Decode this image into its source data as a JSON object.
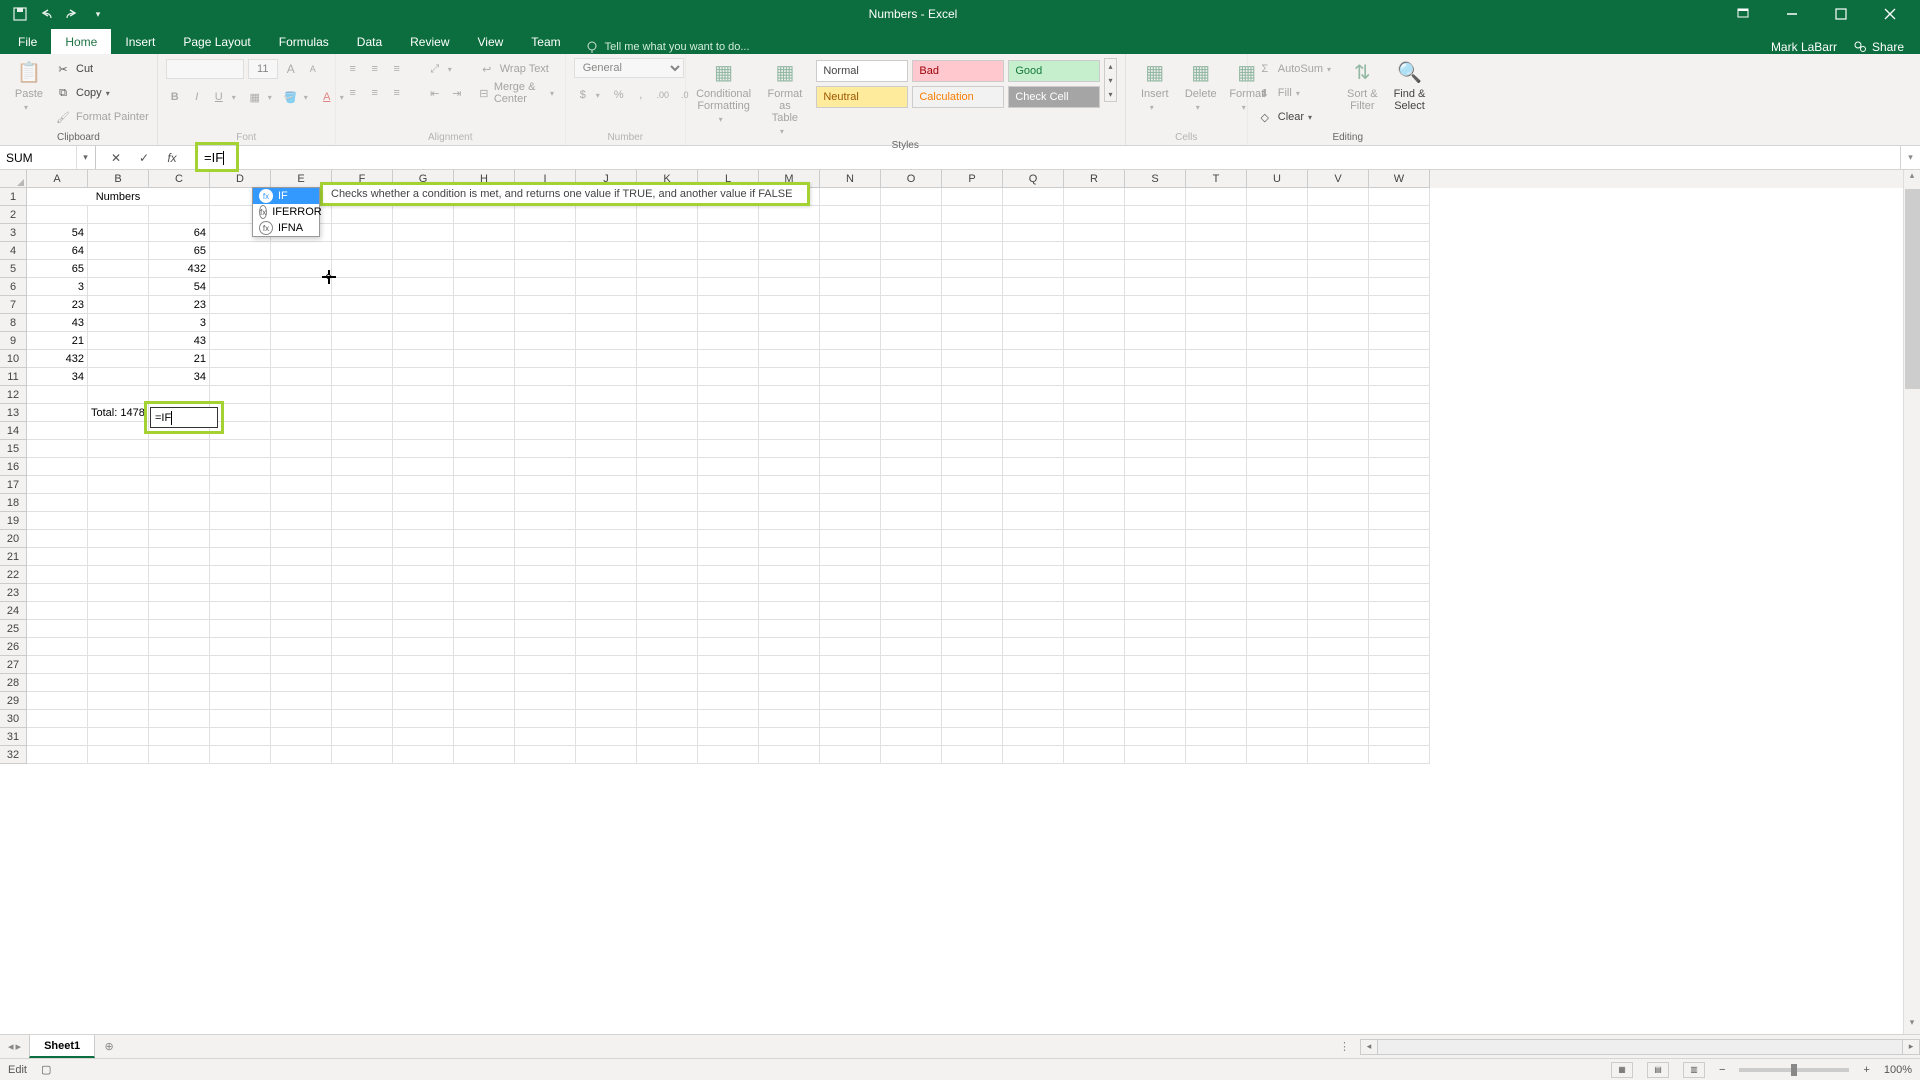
{
  "title": "Numbers - Excel",
  "user": "Mark LaBarr",
  "share": "Share",
  "tabs": {
    "file": "File",
    "home": "Home",
    "insert": "Insert",
    "page_layout": "Page Layout",
    "formulas": "Formulas",
    "data": "Data",
    "review": "Review",
    "view": "View",
    "team": "Team"
  },
  "tell_me": "Tell me what you want to do...",
  "clipboard": {
    "paste": "Paste",
    "cut": "Cut",
    "copy": "Copy",
    "fp": "Format Painter",
    "label": "Clipboard"
  },
  "font": {
    "size": "11",
    "label": "Font"
  },
  "alignment": {
    "wrap": "Wrap Text",
    "merge": "Merge & Center",
    "label": "Alignment"
  },
  "number": {
    "general": "General",
    "label": "Number"
  },
  "styles": {
    "cf": "Conditional\nFormatting",
    "fat": "Format as\nTable",
    "label": "Styles",
    "normal": "Normal",
    "bad": "Bad",
    "good": "Good",
    "neutral": "Neutral",
    "calc": "Calculation",
    "check": "Check Cell"
  },
  "cells": {
    "insert": "Insert",
    "delete": "Delete",
    "format": "Format",
    "label": "Cells"
  },
  "editing": {
    "autosum": "AutoSum",
    "fill": "Fill",
    "clear": "Clear",
    "sort": "Sort &\nFilter",
    "find": "Find &\nSelect",
    "label": "Editing"
  },
  "name_box": "SUM",
  "formula": "=IF",
  "autocomplete": {
    "items": [
      "IF",
      "IFERROR",
      "IFNA"
    ],
    "tooltip": "Checks whether a condition is met, and returns one value if TRUE, and another value if FALSE"
  },
  "columns": [
    "A",
    "B",
    "C",
    "D",
    "E",
    "F",
    "G",
    "H",
    "I",
    "J",
    "K",
    "L",
    "M",
    "N",
    "O",
    "P",
    "Q",
    "R",
    "S",
    "T",
    "U",
    "V",
    "W"
  ],
  "grid": {
    "header_merged": "Numbers",
    "col_a": [
      "54",
      "64",
      "65",
      "3",
      "23",
      "43",
      "21",
      "432",
      "34"
    ],
    "col_c": [
      "64",
      "65",
      "432",
      "54",
      "23",
      "3",
      "43",
      "21",
      "34"
    ],
    "b13": "Total: 1478",
    "c13": "=IF"
  },
  "sheet": "Sheet1",
  "status": "Edit",
  "zoom": "100%"
}
